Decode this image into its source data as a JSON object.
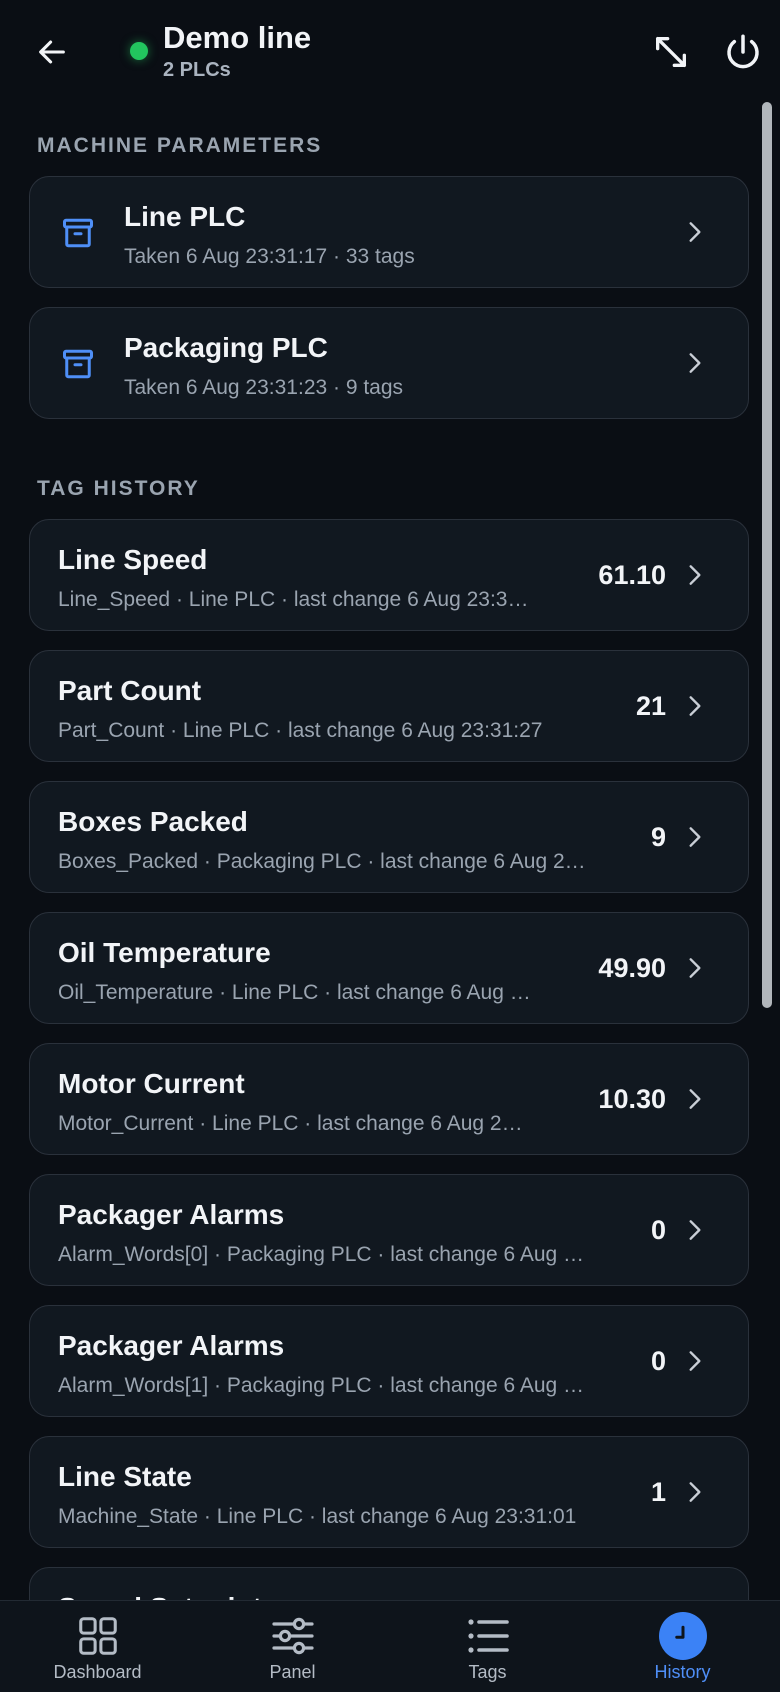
{
  "header": {
    "title": "Demo line",
    "subtitle": "2 PLCs",
    "status_color": "#22c55e"
  },
  "machine_parameters": {
    "label": "MACHINE PARAMETERS",
    "items": [
      {
        "name": "Line PLC",
        "meta": "Taken 6 Aug 23:31:17 · 33 tags",
        "icon": "archive-box-icon"
      },
      {
        "name": "Packaging PLC",
        "meta": "Taken 6 Aug 23:31:23 · 9 tags",
        "icon": "archive-box-icon"
      }
    ]
  },
  "tag_history": {
    "label": "TAG HISTORY",
    "items": [
      {
        "name": "Line Speed",
        "meta": "Line_Speed · Line PLC · last change 6 Aug 23:3…",
        "value": "61.10"
      },
      {
        "name": "Part Count",
        "meta": "Part_Count · Line PLC · last change 6 Aug 23:31:27",
        "value": "21"
      },
      {
        "name": "Boxes Packed",
        "meta": "Boxes_Packed · Packaging PLC · last change 6 Aug 2…",
        "value": "9"
      },
      {
        "name": "Oil Temperature",
        "meta": "Oil_Temperature · Line PLC · last change 6 Aug …",
        "value": "49.90"
      },
      {
        "name": "Motor Current",
        "meta": "Motor_Current · Line PLC · last change 6 Aug 2…",
        "value": "10.30"
      },
      {
        "name": "Packager Alarms",
        "meta": "Alarm_Words[0] · Packaging PLC · last change 6 Aug …",
        "value": "0"
      },
      {
        "name": "Packager Alarms",
        "meta": "Alarm_Words[1] · Packaging PLC · last change 6 Aug …",
        "value": "0"
      },
      {
        "name": "Line State",
        "meta": "Machine_State · Line PLC · last change 6 Aug 23:31:01",
        "value": "1"
      },
      {
        "name": "Speed Setpoint",
        "meta": "",
        "value": ""
      }
    ]
  },
  "nav": {
    "items": [
      {
        "label": "Dashboard",
        "icon": "grid-icon"
      },
      {
        "label": "Panel",
        "icon": "sliders-icon"
      },
      {
        "label": "Tags",
        "icon": "list-icon"
      },
      {
        "label": "History",
        "icon": "clock-icon",
        "active": true
      }
    ],
    "active_color": "#3b82f6"
  }
}
